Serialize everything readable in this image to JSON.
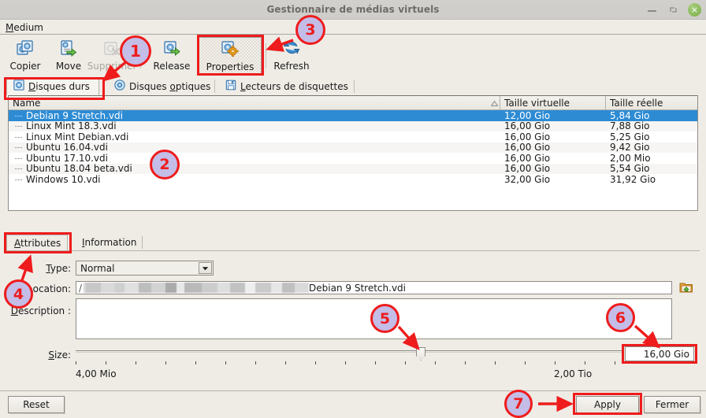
{
  "window": {
    "title": "Gestionnaire de médias virtuels",
    "controls": {
      "minimize": "minimize-icon",
      "maximize": "maximize-icon",
      "close": "×"
    }
  },
  "menubar": {
    "medium": "Medium"
  },
  "toolbar": {
    "buttons": [
      {
        "label": "Copier",
        "icon": "copy-disk-icon",
        "disabled": false
      },
      {
        "label": "Move",
        "icon": "move-disk-icon",
        "disabled": false
      },
      {
        "label": "Supprimer",
        "icon": "delete-disk-icon",
        "disabled": true
      },
      {
        "label": "Release",
        "icon": "release-disk-icon",
        "disabled": false
      },
      {
        "label": "Properties",
        "icon": "properties-disk-icon",
        "disabled": false,
        "pressed": true
      },
      {
        "label": "Refresh",
        "icon": "refresh-icon",
        "disabled": false
      }
    ]
  },
  "media_tabs": [
    {
      "label": "Disques durs",
      "mnemonic": "D",
      "icon": "hard-disk-icon",
      "active": true
    },
    {
      "label": "Disques optiques",
      "mnemonic": "o",
      "icon": "optical-disc-icon",
      "active": false
    },
    {
      "label": "Lecteurs de disquettes",
      "mnemonic": "L",
      "icon": "floppy-disk-icon",
      "active": false
    }
  ],
  "table": {
    "columns": [
      "Name",
      "Taille virtuelle",
      "Taille réelle"
    ],
    "sort_indicator": "ascending-sort-icon",
    "rows": [
      {
        "name": "Debian 9 Stretch.vdi",
        "virtual": "12,00 Gio",
        "actual": "5,84 Gio",
        "selected": true
      },
      {
        "name": "Linux Mint 18.3.vdi",
        "virtual": "16,00 Gio",
        "actual": "7,88 Gio",
        "selected": false
      },
      {
        "name": "Linux Mint Debian.vdi",
        "virtual": "16,00 Gio",
        "actual": "5,25 Gio",
        "selected": false
      },
      {
        "name": "Ubuntu 16.04.vdi",
        "virtual": "16,00 Gio",
        "actual": "9,42 Gio",
        "selected": false
      },
      {
        "name": "Ubuntu 17.10.vdi",
        "virtual": "16,00 Gio",
        "actual": "2,00 Mio",
        "selected": false
      },
      {
        "name": "Ubuntu 18.04 beta.vdi",
        "virtual": "16,00 Gio",
        "actual": "5,54 Gio",
        "selected": false
      },
      {
        "name": "Windows 10.vdi",
        "virtual": "32,00 Gio",
        "actual": "31,92 Gio",
        "selected": false
      }
    ]
  },
  "attr_tabs": [
    {
      "label": "Attributes",
      "mnemonic": "A",
      "active": true
    },
    {
      "label": "Information",
      "mnemonic": "I",
      "active": false
    }
  ],
  "attributes": {
    "type_label": "Type:",
    "type_value": "Normal",
    "location_label": "Location:",
    "location_value": "Debian 9 Stretch.vdi",
    "location_prefix": "/",
    "description_label": "Description :",
    "description_value": "",
    "size_label": "Size:",
    "size_value": "16,00 Gio",
    "size_min": "4,00 Mio",
    "size_max": "2,00 Tio",
    "browse_icon": "folder-open-icon"
  },
  "footer": {
    "reset": "Reset",
    "apply": "Apply",
    "close": "Fermer"
  },
  "annotations": {
    "numbers": [
      "1",
      "2",
      "3",
      "4",
      "5",
      "6",
      "7"
    ],
    "circle_fill": "#c3bde8",
    "stroke": "#ee1c1c"
  }
}
